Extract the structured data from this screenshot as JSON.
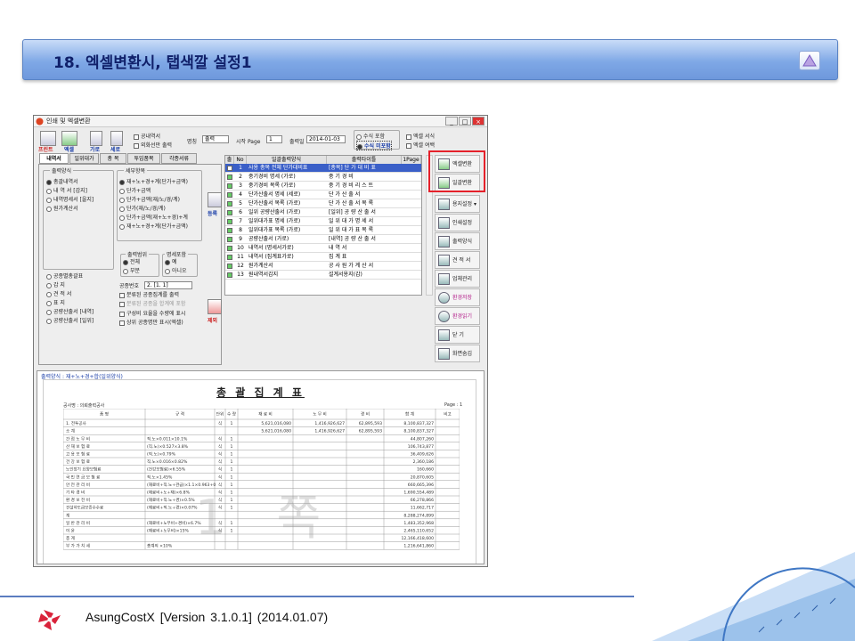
{
  "slide": {
    "title": "18. 엑셀변환시, 탭색깔 설정1",
    "footer": "AsungCostX   [Version 3.1.0.1]   (2014.01.07)"
  },
  "window": {
    "title": "인쇄 및 엑셀변환",
    "controls": [
      "_",
      "□",
      "×"
    ]
  },
  "toolbar": {
    "print": "프린트",
    "excel": "엑셀",
    "landscape": "가로",
    "portrait": "세로",
    "chk_detail": "공내역서",
    "chk_outside": "외화선만 출력",
    "name_label": "명칭",
    "name_value": "출력",
    "page_label": "시작 Page",
    "page_value": "1",
    "date_label": "출력일",
    "date_value": "2014-01-03",
    "formula_incl": "수식 포함",
    "formula_show": "수식 미포함",
    "excel_format": "엑셀 서식",
    "excel_blank": "엑셀 여백"
  },
  "tabs": [
    "내역서",
    "일위대가",
    "총  목",
    "투입품목",
    "각종서류"
  ],
  "output": {
    "group_label": "출력양식",
    "items": [
      "총괄내역서",
      "내  역  서 [갑지]",
      "내역명세서 [을지]",
      "원가계산서"
    ]
  },
  "detail": {
    "group_label": "세부항목",
    "items": [
      "재+노+경+계(단가+금액)",
      "단가+금액",
      "단가+금액(재/노/경/계)",
      "단가(재/노/경/계)",
      "단가+금액(재+노+경)+계",
      "재+노+경+계(단가+금액)"
    ]
  },
  "register": "등록",
  "delete": "제외",
  "lower": {
    "items": [
      "공종별총괄표",
      "갑      지",
      "견  적  서",
      "표      지",
      "공량산출서 [내역]",
      "공량산출서 [일위]"
    ]
  },
  "range": {
    "label": "출력범위",
    "all": "전체",
    "part": "부분",
    "detail_label": "명세포함",
    "yes": "예",
    "no": "아니오"
  },
  "lower2": {
    "code_label": "공종번호",
    "code_value": "2. [1. 1]",
    "c1": "분류된 공종집계를 출력",
    "c2": "분류된 공종을 합계에 포함",
    "c3": "구성비 요율을 수량에 표시",
    "c4": "상위 공종명만 표시(엑셀)"
  },
  "grid": {
    "headers": [
      "출력",
      "No",
      "일괄출력양식",
      "출력타이틀",
      "1Page"
    ],
    "rows": [
      [
        "1",
        "사용 총목 전체 단가대비표",
        "[총목]  단 가 대 비 표"
      ],
      [
        "2",
        "중기경비 명세 (가로)",
        "중   기   경   비"
      ],
      [
        "3",
        "중기경비 목록 (가로)",
        "중 기 경 비 리 스 트"
      ],
      [
        "4",
        "단가산출서 명세 (세로)",
        "단   가   산   출   서"
      ],
      [
        "5",
        "단가산출서 목록 (가로)",
        "단 가 산 출 서 목 록"
      ],
      [
        "6",
        "일위 공량산출서 (가로)",
        "[일위]  공 량 산 출 서"
      ],
      [
        "7",
        "일위대가표 명세 (가로)",
        "일 위 대 가 명 세 서"
      ],
      [
        "8",
        "일위대가표 목록 (가로)",
        "일 위 대 가 표 목 록"
      ],
      [
        "9",
        "공량산출서 (가로)",
        "[내역]  공 량 산 출 서"
      ],
      [
        "10",
        "내역서 (명세서가로)",
        "내         역         서"
      ],
      [
        "11",
        "내역서 (집계표가로)",
        "집         계         표"
      ],
      [
        "12",
        "원가계산서",
        "공 사 원 가 계 산 서"
      ],
      [
        "13",
        "원내역서갑지",
        "설계서용지(갑)"
      ]
    ]
  },
  "side": {
    "excel_conv": "엑셀변환",
    "batch_conv": "일괄변환",
    "paper": "용지설정 ▾",
    "print_set": "인쇄설정",
    "output_form": "출력양식",
    "estimate": "견 적 서",
    "company": "업체관리",
    "env_save": "환경저장",
    "env_load": "환경읽기",
    "close": "닫    기",
    "zoom": "화면숨김"
  },
  "preview": {
    "caption": "출력양식 : 재+노+경+합(일위양식)",
    "sheet_title": "총 괄 집 계 표",
    "project": "공사명 : 의뢰출력공사",
    "page": "Page : 1",
    "watermark": "1 쪽",
    "headers": [
      "품    명",
      "규    격",
      "단위",
      "수  량",
      "재 료 비",
      "노 무 비",
      "경    비",
      "합    계",
      "비고"
    ],
    "rows": [
      [
        "1. 전투공사",
        "",
        "식",
        "1",
        "5,621,016,080",
        "1,416,926,627",
        "62,895,593",
        "8,100,837,327"
      ],
      [
        "소      계",
        "",
        "",
        "",
        "5,621,016,080",
        "1,416,926,627",
        "62,895,593",
        "8,100,837,327"
      ],
      [
        "간 접 노 무 비",
        "직.노×0.011×10.1%",
        "식",
        "1",
        "",
        "",
        "",
        "44,807,260"
      ],
      [
        "산 재 보 험 료",
        "(직.노)×0.527×3.8%",
        "식",
        "1",
        "",
        "",
        "",
        "106,743,877"
      ],
      [
        "고 용 보 험 료",
        "(직.노)×0.79%",
        "식",
        "1",
        "",
        "",
        "",
        "36,409,626"
      ],
      [
        "건 강 보 험 료",
        "직.노×0.016×0.82%",
        "식",
        "1",
        "",
        "",
        "",
        "2,360,186"
      ],
      [
        "노인장기 요양보험료",
        "(건강보험료)×6.55%",
        "식",
        "1",
        "",
        "",
        "",
        "160,660"
      ],
      [
        "국 민 연 금 보 험 료",
        "직.노×1.45%",
        "식",
        "1",
        "",
        "",
        "",
        "20,870,605"
      ],
      [
        "안 전 관 리 비",
        "(재료비+직.노+관급)×1.1×0.963+0",
        "식",
        "1",
        "",
        "",
        "",
        "660,665,396"
      ],
      [
        "기 타 경 비",
        "(재료비+노+재)×6.8%",
        "식",
        "1",
        "",
        "",
        "",
        "1,690,554,489"
      ],
      [
        "환 경 보 전 비",
        "(재료비+직.노+경)×0.5%",
        "식",
        "1",
        "",
        "",
        "",
        "66,278,866"
      ],
      [
        "건설하도급보증수수료",
        "(재료비+직.노+경)×0.07%",
        "식",
        "1",
        "",
        "",
        "",
        "11,662,717"
      ],
      [
        "계",
        "",
        "",
        "",
        "",
        "",
        "",
        "8,288,274,899"
      ],
      [
        "일 반 관 리 비",
        "(재료비+노무비+경비)×6.7%",
        "식",
        "1",
        "",
        "",
        "",
        "1,483,352,968"
      ],
      [
        "이      윤",
        "(재료비+노무비)×15%",
        "식",
        "1",
        "",
        "",
        "",
        "2,465,110,652"
      ],
      [
        "총      계",
        "",
        "",
        "",
        "",
        "",
        "",
        "12,166,418,600"
      ],
      [
        "부 가 가 치 세",
        "총계의 ×10%",
        "",
        "",
        "",
        "",
        "",
        "1,216,641,860"
      ]
    ]
  }
}
